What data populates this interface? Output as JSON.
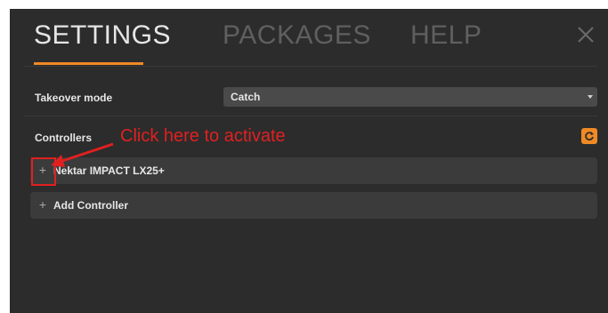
{
  "tabs": [
    {
      "label": "SETTINGS",
      "active": true
    },
    {
      "label": "PACKAGES",
      "active": false
    },
    {
      "label": "HELP",
      "active": false
    }
  ],
  "header": {
    "close_icon": "close-icon"
  },
  "takeover": {
    "label": "Takeover mode",
    "value": "Catch"
  },
  "controllers": {
    "label": "Controllers",
    "refresh_icon": "refresh-icon",
    "items": [
      {
        "label": "Nektar IMPACT LX25+",
        "icon": "plus-icon"
      }
    ],
    "add_label": "Add Controller"
  },
  "annotation": {
    "text": "Click here to activate",
    "color": "#e02020"
  },
  "colors": {
    "accent": "#f08a24",
    "background": "#2c2c2c",
    "row": "#3b3b3b"
  }
}
